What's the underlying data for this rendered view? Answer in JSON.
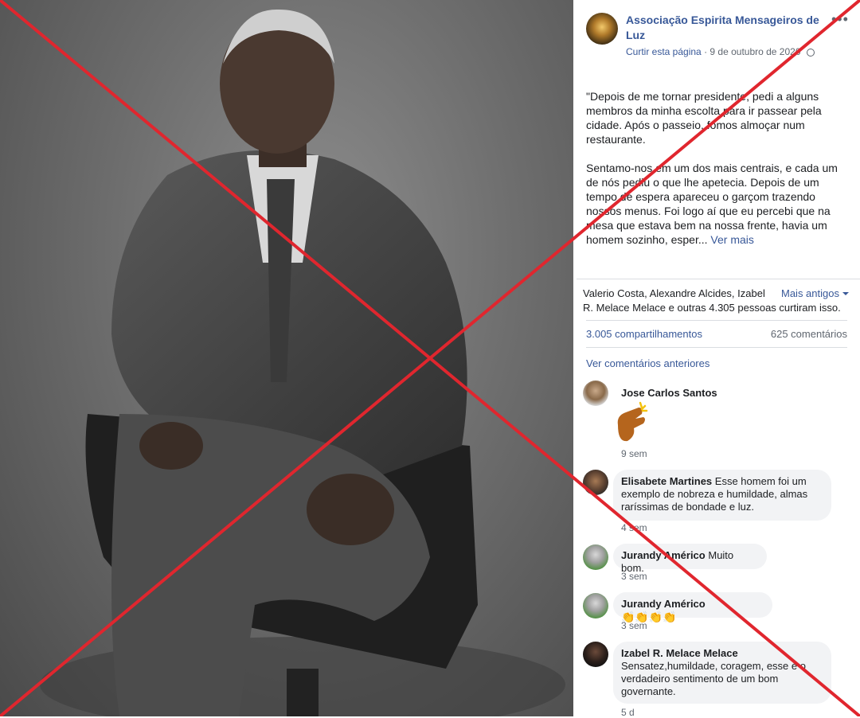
{
  "post": {
    "page_name": "Associação Espirita Mensageiros de Luz",
    "like_link": "Curtir esta página",
    "date": "9 de outubro de 2020",
    "menu_icon": "more-dots-icon",
    "privacy_icon": "globe-icon",
    "paragraph1": "\"Depois de me tornar presidente, pedi a alguns membros da minha escolta para ir passear pela cidade. Após o passeio, fomos almoçar num restaurante.",
    "paragraph2": "Sentamo-nos em um dos mais centrais, e cada um de nós pediu o que lhe apetecia. Depois de um tempo de espera apareceu o garçom trazendo nossos menus. Foi logo aí que eu percebi que na mesa que estava bem na nossa frente, havia um homem sozinho, esper...",
    "see_more": "Ver mais"
  },
  "reactions": {
    "likers_line1": "Valerio Costa, Alexandre Alcides, Izabel",
    "likers_line2": "R. Melace Melace e outras 4.305 pessoas curtiram isso.",
    "older_label": "Mais antigos",
    "shares": "3.005 compartilhamentos",
    "comments": "625 comentários",
    "previous_comments": "Ver comentários anteriores"
  },
  "comments": [
    {
      "author": "Jose Carlos Santos",
      "text": "",
      "time": "9 sem"
    },
    {
      "author": "Elisabete Martines",
      "text": "Esse homem foi um exemplo de nobreza e humildade, almas raríssimas de bondade e luz.",
      "time": "4 sem"
    },
    {
      "author": "Jurandy Américo",
      "text": "Muito bom.",
      "time": "3 sem"
    },
    {
      "author": "Jurandy Américo",
      "text": "👏👏👏👏",
      "time": "3 sem"
    },
    {
      "author": "Izabel R. Melace Melace",
      "text": "Sensatez,humildade, coragem, esse é o verdadeiro sentimento de um bom governante.",
      "time": "5 d"
    }
  ],
  "colors": {
    "link": "#385898",
    "cross": "#e0262e",
    "bubble": "#f2f3f5"
  }
}
